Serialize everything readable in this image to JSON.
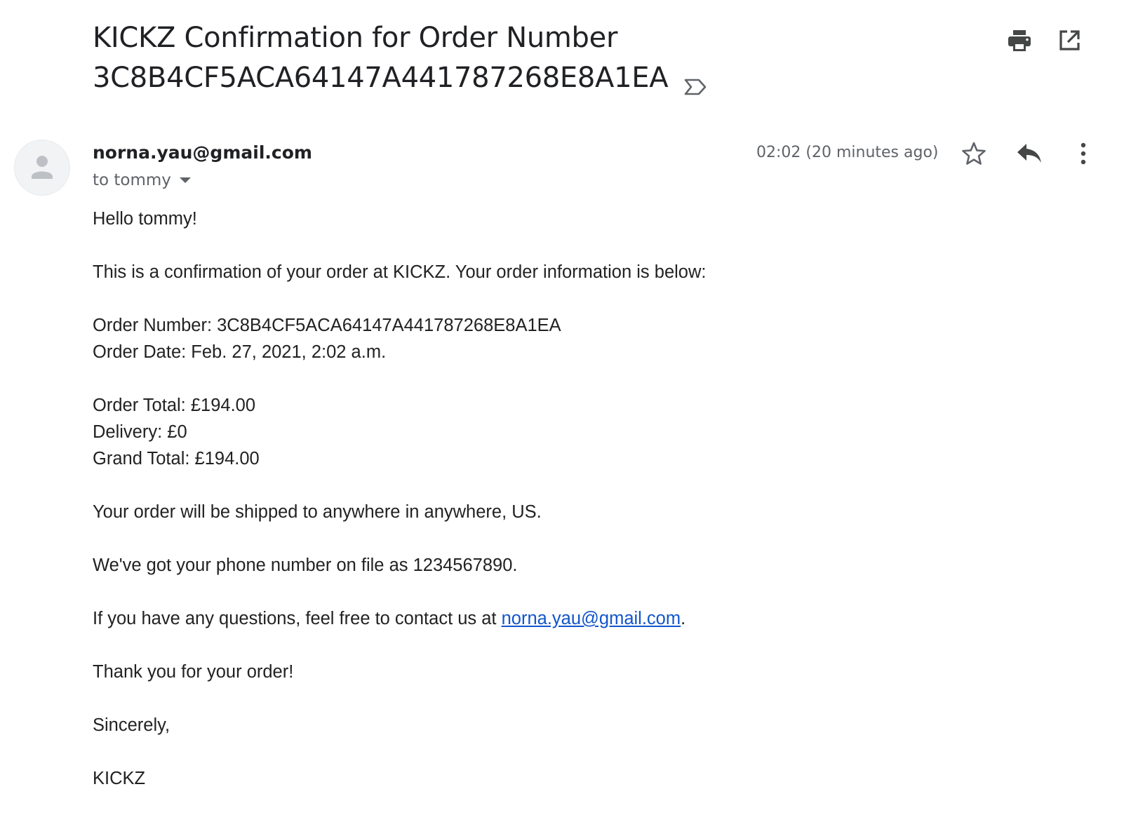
{
  "subject": {
    "text": "KICKZ Confirmation for Order Number 3C8B4CF5ACA64147A441787268E8A1EA",
    "label_icon": "important-label-icon"
  },
  "toolbar": {
    "print_icon": "print-icon",
    "open_new_window_icon": "open-in-new-window-icon"
  },
  "message": {
    "sender": "norna.yau@gmail.com",
    "recipient": "to tommy",
    "timestamp": "02:02 (20 minutes ago)",
    "icons": [
      "star-icon",
      "reply-icon",
      "more-vert-icon"
    ]
  },
  "body": {
    "greeting": "Hello tommy!",
    "intro": "This is a confirmation of your order at KICKZ. Your order information is below:",
    "order_number": "Order Number: 3C8B4CF5ACA64147A441787268E8A1EA",
    "order_date": "Order Date: Feb. 27, 2021, 2:02 a.m.",
    "order_total": "Order Total: £194.00",
    "delivery": "Delivery: £0",
    "grand_total": "Grand Total: £194.00",
    "shipping": "Your order will be shipped to anywhere in anywhere, US.",
    "phone": "We've got your phone number on file as 1234567890.",
    "contact_prefix": "If you have any questions, feel free to contact us at ",
    "contact_email": "norna.yau@gmail.com",
    "contact_suffix": ".",
    "thanks": "Thank you for your order!",
    "closing": "Sincerely,",
    "signature": "KICKZ"
  }
}
